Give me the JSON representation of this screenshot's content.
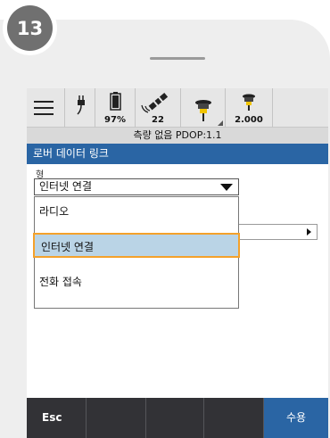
{
  "step_badge": "13",
  "status_bar": {
    "battery": "97%",
    "satellites": "22",
    "antenna_height": "2.000",
    "position_status": "측량 없음 PDOP:1.1"
  },
  "title": "로버 데이터 링크",
  "type_field": {
    "label": "형",
    "value": "인터넷 연결"
  },
  "dropdown_options": [
    "라디오",
    "인터넷 연결",
    "전화 접속"
  ],
  "selected_option_index": 1,
  "bottom_bar": {
    "esc": "Esc",
    "accept": "수용"
  },
  "colors": {
    "accent": "#2a65a4",
    "highlight_border": "#f4a12b",
    "selected_bg": "#bad4e6",
    "bottom_bar": "#323236",
    "badge": "#707070"
  }
}
